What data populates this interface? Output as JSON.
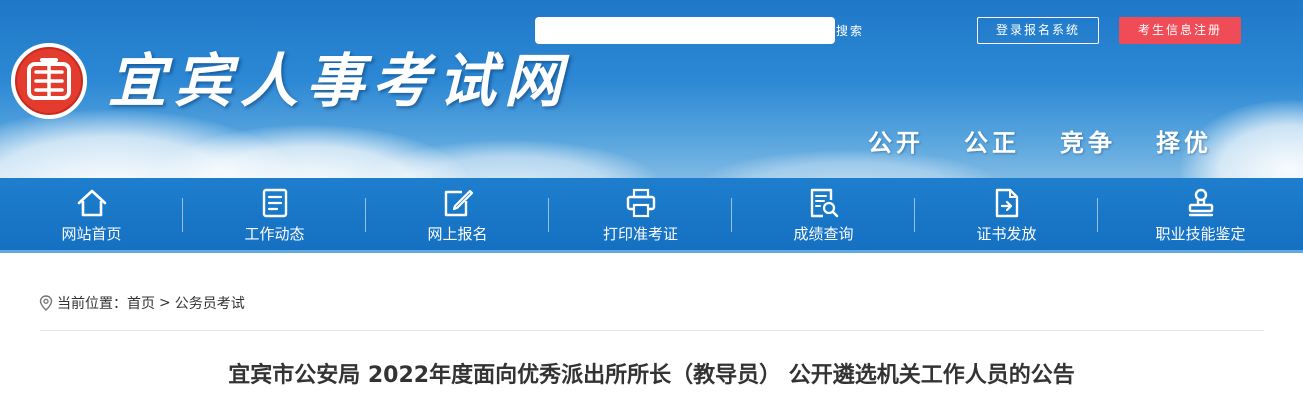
{
  "header": {
    "site_title": "宜宾人事考试网",
    "logo_text": "宜",
    "search": {
      "placeholder": "",
      "button_label": "搜索"
    },
    "login_button": "登录报名系统",
    "register_button": "考生信息注册",
    "slogan": [
      "公开",
      "公正",
      "竞争",
      "择优"
    ]
  },
  "nav": {
    "items": [
      {
        "label": "网站首页",
        "icon": "home-icon"
      },
      {
        "label": "工作动态",
        "icon": "document-list-icon"
      },
      {
        "label": "网上报名",
        "icon": "edit-icon"
      },
      {
        "label": "打印准考证",
        "icon": "printer-icon"
      },
      {
        "label": "成绩查询",
        "icon": "search-document-icon"
      },
      {
        "label": "证书发放",
        "icon": "certificate-file-icon"
      },
      {
        "label": "职业技能鉴定",
        "icon": "stamp-icon"
      }
    ]
  },
  "breadcrumb": {
    "prefix": "当前位置：",
    "items": [
      "首页",
      "公务员考试"
    ],
    "separator": ">"
  },
  "article": {
    "title": "宜宾市公安局 2022年度面向优秀派出所所长（教导员） 公开遴选机关工作人员的公告"
  },
  "colors": {
    "nav_bg": "#1570c2",
    "banner_top": "#1f78c8",
    "register_btn": "#f04c58",
    "seal_red": "#e33b2e"
  }
}
